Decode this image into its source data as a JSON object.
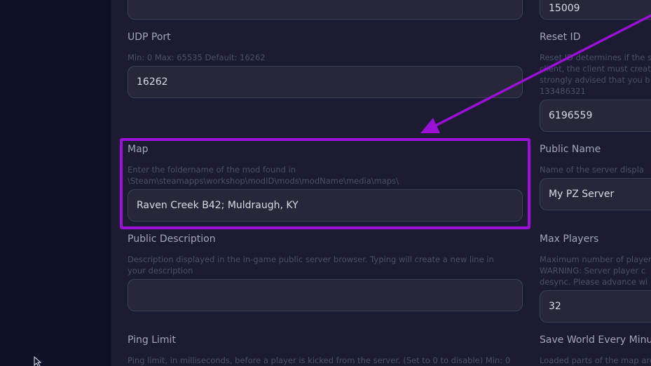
{
  "form": {
    "prev_left_value": "",
    "prev_right_value": "15009",
    "udp_port": {
      "label": "UDP Port",
      "desc": "Min: 0 Max: 65535 Default: 16262",
      "value": "16262"
    },
    "reset_id": {
      "label": "Reset ID",
      "desc_lines": [
        "Reset ID determines if the s",
        "client, the client must creat",
        "strongly advised that you b",
        "133486321"
      ],
      "value": "6196559"
    },
    "map": {
      "label": "Map",
      "desc_lines": [
        "Enter the foldername of the mod found in",
        "\\Steam\\steamapps\\workshop\\modID\\mods\\modName\\media\\maps\\"
      ],
      "value": "Raven Creek B42; Muldraugh, KY"
    },
    "public_name": {
      "label": "Public Name",
      "desc": "Name of the server displa",
      "value": "My PZ Server"
    },
    "public_description": {
      "label": "Public Description",
      "desc_lines": [
        "Description displayed in the in-game public server browser. Typing will create a new line in",
        "your description"
      ],
      "value": ""
    },
    "max_players": {
      "label": "Max Players",
      "desc_lines": [
        "Maximum number of player",
        "WARNING: Server player c",
        "desync. Please advance wi"
      ],
      "value": "32"
    },
    "ping_limit": {
      "label": "Ping Limit",
      "desc": "Ping limit, in milliseconds, before a player is kicked from the server. (Set to 0 to disable) Min: 0"
    },
    "save_world": {
      "label": "Save World Every Minut",
      "desc": "Loaded parts of the map are"
    }
  },
  "colors": {
    "highlight": "#9a10d6",
    "arrow": "#9a10d6"
  }
}
